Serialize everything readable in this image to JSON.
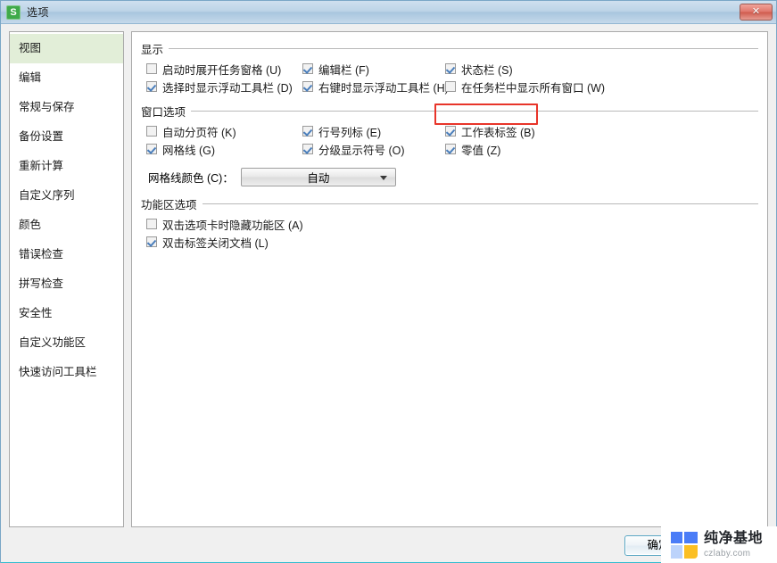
{
  "window": {
    "title": "选项",
    "logo_letter": "S",
    "close_label": "✕"
  },
  "sidebar": {
    "items": [
      {
        "label": "视图",
        "selected": true
      },
      {
        "label": "编辑",
        "selected": false
      },
      {
        "label": "常规与保存",
        "selected": false
      },
      {
        "label": "备份设置",
        "selected": false
      },
      {
        "label": "重新计算",
        "selected": false
      },
      {
        "label": "自定义序列",
        "selected": false
      },
      {
        "label": "颜色",
        "selected": false
      },
      {
        "label": "错误检查",
        "selected": false
      },
      {
        "label": "拼写检查",
        "selected": false
      },
      {
        "label": "安全性",
        "selected": false
      },
      {
        "label": "自定义功能区",
        "selected": false
      },
      {
        "label": "快速访问工具栏",
        "selected": false
      }
    ]
  },
  "groups": {
    "display": {
      "title": "显示",
      "rows": [
        [
          {
            "label": "启动时展开任务窗格 (U)",
            "checked": false
          },
          {
            "label": "编辑栏 (F)",
            "checked": true
          },
          {
            "label": "状态栏 (S)",
            "checked": true
          }
        ],
        [
          {
            "label": "选择时显示浮动工具栏 (D)",
            "checked": true
          },
          {
            "label": "右键时显示浮动工具栏 (H)",
            "checked": true
          },
          {
            "label": "在任务栏中显示所有窗口 (W)",
            "checked": false
          }
        ]
      ]
    },
    "window_options": {
      "title": "窗口选项",
      "rows": [
        [
          {
            "label": "自动分页符 (K)",
            "checked": false
          },
          {
            "label": "行号列标 (E)",
            "checked": true
          },
          {
            "label": "工作表标签 (B)",
            "checked": true,
            "highlight": true
          }
        ],
        [
          {
            "label": "网格线 (G)",
            "checked": true
          },
          {
            "label": "分级显示符号 (O)",
            "checked": true
          },
          {
            "label": "零值 (Z)",
            "checked": true
          }
        ]
      ],
      "gridline_color_label": "网格线颜色 (C)：",
      "gridline_color_value": "自动"
    },
    "ribbon_options": {
      "title": "功能区选项",
      "rows": [
        {
          "label": "双击选项卡时隐藏功能区 (A)",
          "checked": false
        },
        {
          "label": "双击标签关闭文档 (L)",
          "checked": true
        }
      ]
    }
  },
  "footer": {
    "ok_label": "确定"
  },
  "watermark": {
    "cn": "纯净基地",
    "en": "czlaby.com"
  },
  "colors": {
    "accent_red": "#e8352a",
    "selected_sidebar": "#e2eed8",
    "checkmark": "#4a7ebb",
    "footer_line": "#35bdd0"
  }
}
